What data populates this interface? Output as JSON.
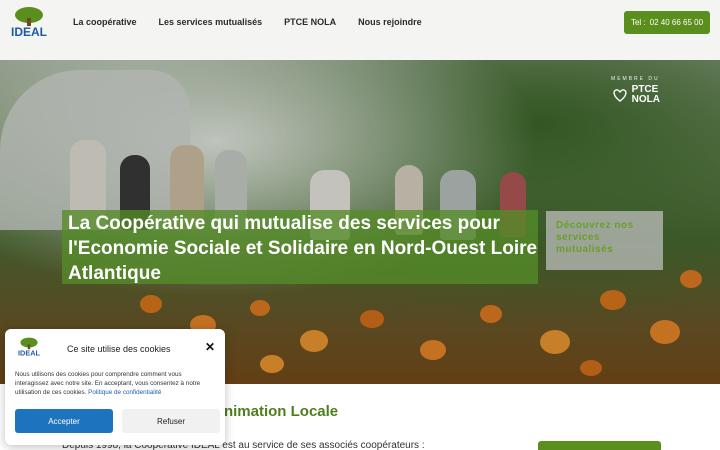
{
  "header": {
    "logo_text": "IDEAL",
    "nav": [
      "La coopérative",
      "Les services mutualisés",
      "PTCE NOLA",
      "Nous rejoindre"
    ],
    "phone": "02 40 66 65 00",
    "phone_prefix": "Tel :"
  },
  "hero": {
    "badge_top": "MEMBRE DU",
    "badge_name_line1": "PTCE",
    "badge_name_line2": "NOLA",
    "title": "La Coopérative qui mutualise des services pour l'Economie Sociale et Solidaire en Nord-Ouest Loire Atlantique",
    "discover_button": "Découvrez nos services mutualisés"
  },
  "section": {
    "title": "ment Economique et Animation Locale",
    "text": "Depuis 1998, la Coopérative IDEAL est au service de ses associés coopérateurs :"
  },
  "cookie": {
    "logo_text": "IDEAL",
    "title": "Ce site utilise des cookies",
    "text": "Nous utilisons des cookies pour comprendre comment vous interagissez avec notre site. En acceptant, vous consentez à notre utilisation de ces cookies.",
    "policy_link": "Politique de confidentialité",
    "accept": "Accepter",
    "refuse": "Refuser"
  },
  "colors": {
    "accent_green": "#5a8f1e",
    "accept_blue": "#1e73be"
  }
}
